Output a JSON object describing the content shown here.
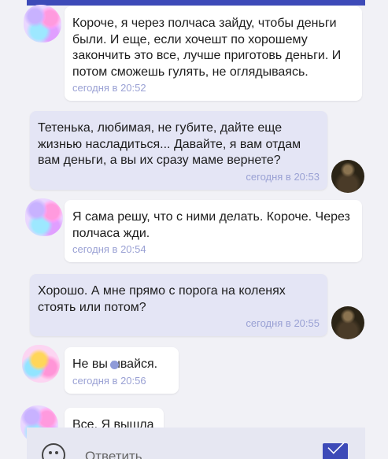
{
  "messages": [
    {
      "text": "Короче, я через полчаса зайду, чтобы деньги были. И еще, если хочешт по хорошему закончить это все, лучше приготовь деньги. И потом сможешь гулять, не оглядываясь.",
      "time": "сегодня в 20:52"
    },
    {
      "text": "Тетенька, любимая, не губите, дайте еще жизнью насладиться... Давайте, я вам отдам вам деньги, а вы их сразу маме вернете?",
      "time": "сегодня в 20:53"
    },
    {
      "text": "Я сама решу, что с ними делать. Короче. Через полчаса жди.",
      "time": "сегодня в 20:54"
    },
    {
      "text": "Хорошо. А мне прямо с порога на коленях стоять или потом?",
      "time": "сегодня в 20:55"
    },
    {
      "text": "Не вы ывайся.",
      "time": "сегодня в 20:56"
    },
    {
      "text": "Все. Я вышла",
      "time": ""
    }
  ],
  "composer": {
    "placeholder": "Ответить"
  },
  "colors": {
    "accent": "#3d4ab8",
    "incoming_bg": "#ffffff",
    "outgoing_bg": "#e4e5f5",
    "timestamp": "#9aa1d4"
  }
}
